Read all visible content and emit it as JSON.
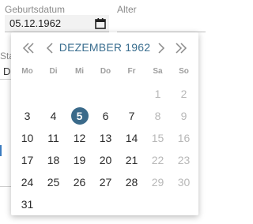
{
  "form": {
    "birthdate_label": "Geburtsdatum",
    "birthdate_value": "05.12.1962",
    "age_label": "Alter",
    "fragment_status": "Sta",
    "fragment_d": "D"
  },
  "datepicker": {
    "month_title": "DEZEMBER 1962",
    "weekdays": [
      "Mo",
      "Di",
      "Mi",
      "Do",
      "Fr",
      "Sa",
      "So"
    ],
    "weeks": [
      [
        "",
        "",
        "",
        "",
        "",
        "1",
        "2"
      ],
      [
        "3",
        "4",
        "5",
        "6",
        "7",
        "8",
        "9"
      ],
      [
        "10",
        "11",
        "12",
        "13",
        "14",
        "15",
        "16"
      ],
      [
        "17",
        "18",
        "19",
        "20",
        "21",
        "22",
        "23"
      ],
      [
        "24",
        "25",
        "26",
        "27",
        "28",
        "29",
        "30"
      ],
      [
        "31",
        "",
        "",
        "",
        "",
        "",
        ""
      ]
    ],
    "selected_day": "5",
    "icons": {
      "prev_year": "double-chevron-left-icon",
      "prev_month": "chevron-left-icon",
      "next_month": "chevron-right-icon",
      "next_year": "double-chevron-right-icon",
      "calendar": "calendar-icon"
    }
  },
  "colors": {
    "accent": "#3a6e8f",
    "selected_bg": "#3a6a8a",
    "weekend_text": "#b8b8b8",
    "weekday_header": "#9e9e9e"
  }
}
